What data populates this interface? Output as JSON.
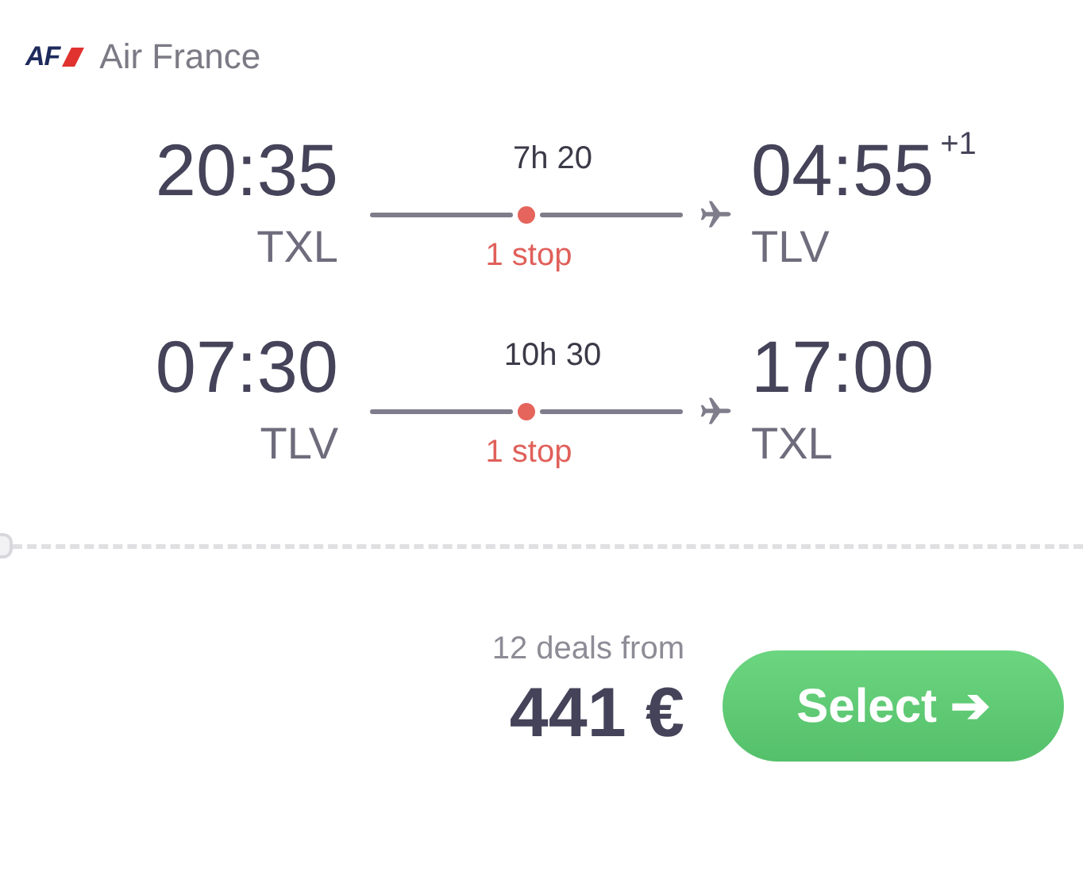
{
  "airline": {
    "logo_text": "AF",
    "name": "Air France"
  },
  "legs": [
    {
      "depart_time": "20:35",
      "depart_airport": "TXL",
      "duration": "7h 20",
      "stops": "1 stop",
      "arrive_time": "04:55",
      "day_offset": "+1",
      "arrive_airport": "TLV"
    },
    {
      "depart_time": "07:30",
      "depart_airport": "TLV",
      "duration": "10h 30",
      "stops": "1 stop",
      "arrive_time": "17:00",
      "arrive_airport": "TXL"
    }
  ],
  "footer": {
    "deals": "12 deals from",
    "price": "441 €",
    "select_button": {
      "label": "Select",
      "arrow": "➔"
    }
  }
}
